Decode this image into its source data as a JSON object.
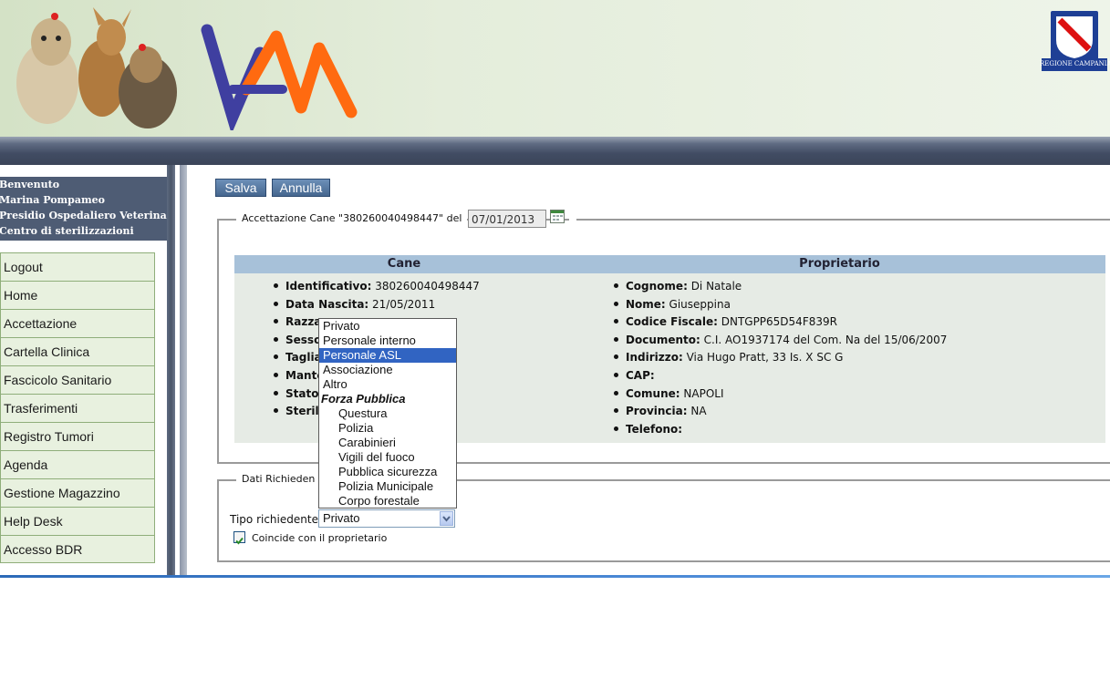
{
  "header": {
    "logo_alt": "logo-vam",
    "region_label": "REGIONE CAMPANIA"
  },
  "welcome": {
    "lines": [
      "Benvenuto",
      "Marina Pompameo",
      "Presidio Ospedaliero Veterinario",
      "Centro di sterilizzazioni"
    ]
  },
  "menu": {
    "items": [
      "Logout",
      "Home",
      "Accettazione",
      "Cartella Clinica",
      "Fascicolo Sanitario",
      "Trasferimenti",
      "Registro Tumori",
      "Agenda",
      "Gestione Magazzino",
      "Help Desk",
      "Accesso BDR"
    ]
  },
  "toolbar": {
    "save_label": "Salva",
    "cancel_label": "Annulla"
  },
  "accettazione": {
    "legend": "Accettazione Cane \"380260040498447\" del",
    "date": "07/01/2013"
  },
  "table": {
    "head_cane": "Cane",
    "head_prop": "Proprietario",
    "cane": [
      {
        "k": "Identificativo:",
        "v": " 380260040498447"
      },
      {
        "k": "Data Nascita:",
        "v": " 21/05/2011"
      },
      {
        "k": "Razza",
        "v": ""
      },
      {
        "k": "Sesso",
        "v": ""
      },
      {
        "k": "Taglia",
        "v": ""
      },
      {
        "k": "Mante",
        "v": ""
      },
      {
        "k": "Stato",
        "v": ""
      },
      {
        "k": "Sterili",
        "v": ""
      }
    ],
    "prop": [
      {
        "k": "Cognome:",
        "v": " Di Natale"
      },
      {
        "k": "Nome:",
        "v": " Giuseppina"
      },
      {
        "k": "Codice Fiscale:",
        "v": " DNTGPP65D54F839R"
      },
      {
        "k": "Documento:",
        "v": " C.I. AO1937174 del Com. Na del 15/06/2007"
      },
      {
        "k": "Indirizzo:",
        "v": " Via Hugo Pratt, 33 Is. X SC G"
      },
      {
        "k": "CAP:",
        "v": ""
      },
      {
        "k": "Comune:",
        "v": " NAPOLI"
      },
      {
        "k": "Provincia:",
        "v": " NA"
      },
      {
        "k": "Telefono:",
        "v": ""
      }
    ]
  },
  "richiedente": {
    "legend": "Dati Richieden",
    "tipo_label": "Tipo richiedente",
    "tipo_value": "Privato",
    "checkbox_label": "Coincide con il proprietario",
    "options": [
      {
        "label": "Privato",
        "kind": "opt"
      },
      {
        "label": "Personale interno",
        "kind": "opt"
      },
      {
        "label": "Personale ASL",
        "kind": "sel"
      },
      {
        "label": "Associazione",
        "kind": "opt"
      },
      {
        "label": "Altro",
        "kind": "opt"
      },
      {
        "label": "Forza Pubblica",
        "kind": "group"
      },
      {
        "label": "Questura",
        "kind": "sub"
      },
      {
        "label": "Polizia",
        "kind": "sub"
      },
      {
        "label": "Carabinieri",
        "kind": "sub"
      },
      {
        "label": "Vigili del fuoco",
        "kind": "sub"
      },
      {
        "label": "Pubblica sicurezza",
        "kind": "sub"
      },
      {
        "label": "Polizia Municipale",
        "kind": "sub"
      },
      {
        "label": "Corpo forestale",
        "kind": "sub"
      }
    ]
  },
  "colors": {
    "menu_bg": "#e8f1df",
    "table_head": "#a7c1d9",
    "selected": "#3164c2"
  }
}
